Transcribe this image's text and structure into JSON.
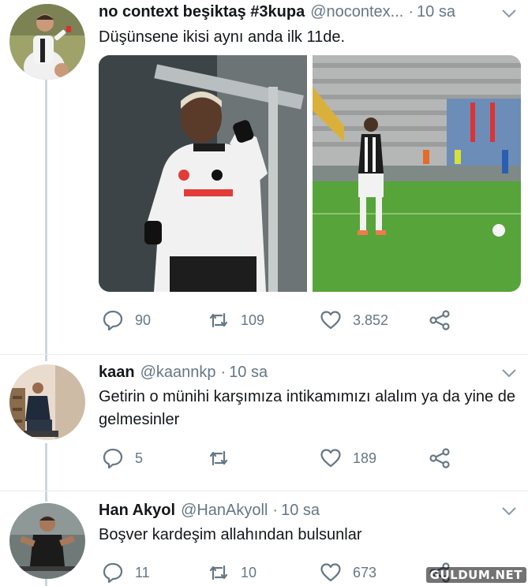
{
  "colors": {
    "text_primary": "#14171a",
    "text_secondary": "#657786",
    "thread_line": "#ccd6dd",
    "divider": "#e6ecf0"
  },
  "tweets": [
    {
      "name": "no context beşiktaş #3kupa",
      "handle": "@nocontex...",
      "separator": "·",
      "time": "10 sa",
      "text": "Düşünsene ikisi aynı anda ilk 11de.",
      "avatar_icon": "footballer-celebration-avatar",
      "media": [
        {
          "icon": "player-celebration-photo"
        },
        {
          "icon": "player-penalty-photo"
        }
      ],
      "stats": {
        "replies": "90",
        "retweets": "109",
        "likes": "3.852"
      }
    },
    {
      "name": "kaan",
      "handle": "@kaannkp",
      "separator": "·",
      "time": "10 sa",
      "text": "Getirin o münihi karşımıza intikamımızı alalım ya da yine de gelmesinler",
      "avatar_icon": "man-sitting-avatar",
      "stats": {
        "replies": "5",
        "retweets": "",
        "likes": "189"
      }
    },
    {
      "name": "Han Akyol",
      "handle": "@HanAkyoll",
      "separator": "·",
      "time": "10 sa",
      "text": "Boşver kardeşim allahından bulsunlar",
      "avatar_icon": "man-gym-avatar",
      "stats": {
        "replies": "11",
        "retweets": "10",
        "likes": "673"
      }
    }
  ],
  "watermark": "GULDUM.NET"
}
